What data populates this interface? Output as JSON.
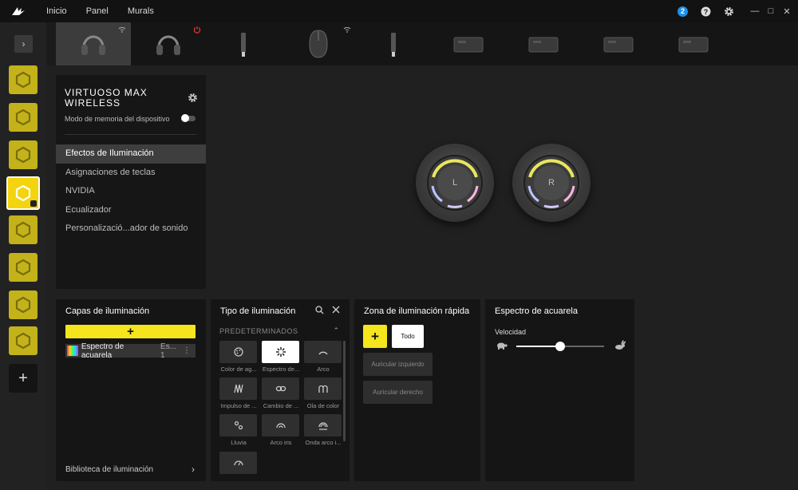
{
  "topnav": {
    "items": [
      "Inicio",
      "Panel",
      "Murals"
    ]
  },
  "topbar": {
    "notification_count": "2"
  },
  "colors": {
    "accent": "#f4e51d",
    "badge": "#1e8fe8"
  },
  "profiles": {
    "count": 8,
    "active_index": 3
  },
  "devices": [
    {
      "icon": "headset-icon",
      "active": true,
      "wireless": true
    },
    {
      "icon": "headset-icon",
      "active": false,
      "power": true
    },
    {
      "icon": "usb-dongle-icon"
    },
    {
      "icon": "mouse-icon",
      "wireless": true
    },
    {
      "icon": "usb-dongle-icon"
    },
    {
      "icon": "controller-hub-icon"
    },
    {
      "icon": "controller-hub-icon"
    },
    {
      "icon": "controller-hub-icon"
    },
    {
      "icon": "controller-hub-icon"
    }
  ],
  "device_panel": {
    "name": "VIRTUOSO MAX WIRELESS",
    "memory_mode_label": "Modo de memoria del dispositivo",
    "memory_mode_on": false,
    "menu": [
      "Efectos de Iluminación",
      "Asignaciones de teclas",
      "NVIDIA",
      "Ecualizador",
      "Personalizació...ador de sonido"
    ]
  },
  "headphones": {
    "left_label": "L",
    "right_label": "R"
  },
  "layers_panel": {
    "title": "Capas de iluminación",
    "add_label": "+",
    "layer_name": "Espectro de acuarela",
    "layer_extra": "Es... 1",
    "more_label": "⋮",
    "library_label": "Biblioteca de iluminación"
  },
  "type_panel": {
    "title": "Tipo de iluminación",
    "section_label": "PREDETERMINADOS",
    "effects": [
      {
        "label": "Color de ag...",
        "icon": "palette-icon"
      },
      {
        "label": "Espectro de...",
        "icon": "spectrum-icon",
        "active": true
      },
      {
        "label": "Arco",
        "icon": "arc-icon"
      },
      {
        "label": "Impulso de ...",
        "icon": "pulse-icon"
      },
      {
        "label": "Cambio de ...",
        "icon": "link-icon"
      },
      {
        "label": "Ola de color",
        "icon": "wave-icon"
      },
      {
        "label": "Lluvia",
        "icon": "rain-icon"
      },
      {
        "label": "Arco iris",
        "icon": "rainbow-icon"
      },
      {
        "label": "Onda arco i...",
        "icon": "rainbow-wave-icon"
      },
      {
        "label": "",
        "icon": "gauge-icon"
      }
    ]
  },
  "zone_panel": {
    "title": "Zona de iluminación rápida",
    "add_label": "+",
    "all_label": "Todo",
    "zones": [
      "Auricular izquierdo",
      "Auricular derecho"
    ]
  },
  "spectrum_panel": {
    "title": "Espectro de acuarela",
    "speed_label": "Velocidad",
    "speed_value": 0.5
  }
}
